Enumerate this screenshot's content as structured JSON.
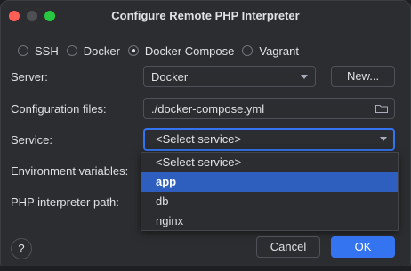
{
  "window": {
    "title": "Configure Remote PHP Interpreter"
  },
  "connection_type": {
    "options": [
      "SSH",
      "Docker",
      "Docker Compose",
      "Vagrant"
    ],
    "selected": "Docker Compose"
  },
  "server": {
    "label": "Server:",
    "value": "Docker",
    "new_button": "New..."
  },
  "config_files": {
    "label": "Configuration files:",
    "value": "./docker-compose.yml"
  },
  "service": {
    "label": "Service:",
    "value": "<Select service>",
    "options": [
      "<Select service>",
      "app",
      "db",
      "nginx"
    ],
    "highlighted": "app"
  },
  "env_vars": {
    "label": "Environment variables:"
  },
  "php_path": {
    "label": "PHP interpreter path:"
  },
  "footer": {
    "help": "?",
    "cancel": "Cancel",
    "ok": "OK"
  },
  "colors": {
    "accent": "#3574f0",
    "selection": "#2e5fbf",
    "background": "#2b2d30"
  }
}
